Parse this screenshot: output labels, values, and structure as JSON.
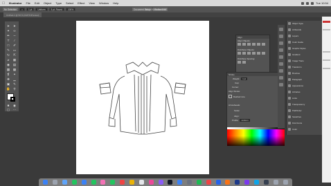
{
  "menubar": {
    "app_name": "Illustrator",
    "items": [
      "File",
      "Edit",
      "Object",
      "Type",
      "Select",
      "Effect",
      "View",
      "Window",
      "Help"
    ],
    "clock": "Tue 10:54"
  },
  "control_bar": {
    "selection": "No Selection",
    "stroke": "1 pt",
    "style": "Uniform",
    "brush": "5 pt. Round",
    "opacity": "100%",
    "doc_setup": "Document Setup",
    "preferences": "Preferences",
    "window_title": "Adobe Illustrator 2022"
  },
  "document_tab": {
    "label": "Untitled-1 @ 50 % (CMYK/Preview)"
  },
  "panels": {
    "align": {
      "title": "Align",
      "sections": [
        "Align Objects:",
        "Distribute Objects:",
        "Distribute Spacing:"
      ]
    },
    "stroke": {
      "title": "Stroke",
      "weight_label": "Weight:",
      "weight_value": "1 pt",
      "cap_label": "Cap:",
      "corner_label": "Corner:",
      "align_stroke_label": "Align Stroke:",
      "dashed_line": "Dashed Line",
      "arrowheads_label": "Arrowheads:",
      "scale_label": "Scale:",
      "align_label": "Align:",
      "profile_label": "Profile:",
      "profile_value": "Uniform"
    },
    "dock": [
      "Object Type",
      "Artboards",
      "Layers",
      "Color Guide",
      "Graphic Styles",
      "Gradient",
      "Image Trace",
      "Transform",
      "Brushes",
      "Paragraph",
      "Appearance",
      "Libraries",
      "Links",
      "Transparency",
      "Pathfinder",
      "Swatches",
      "Find Fonts",
      "Color"
    ]
  },
  "colors": {
    "menubar": "#d9d9d9",
    "workspace": "#3a3a3a",
    "panel": "#535353",
    "artboard": "#ffffff"
  }
}
